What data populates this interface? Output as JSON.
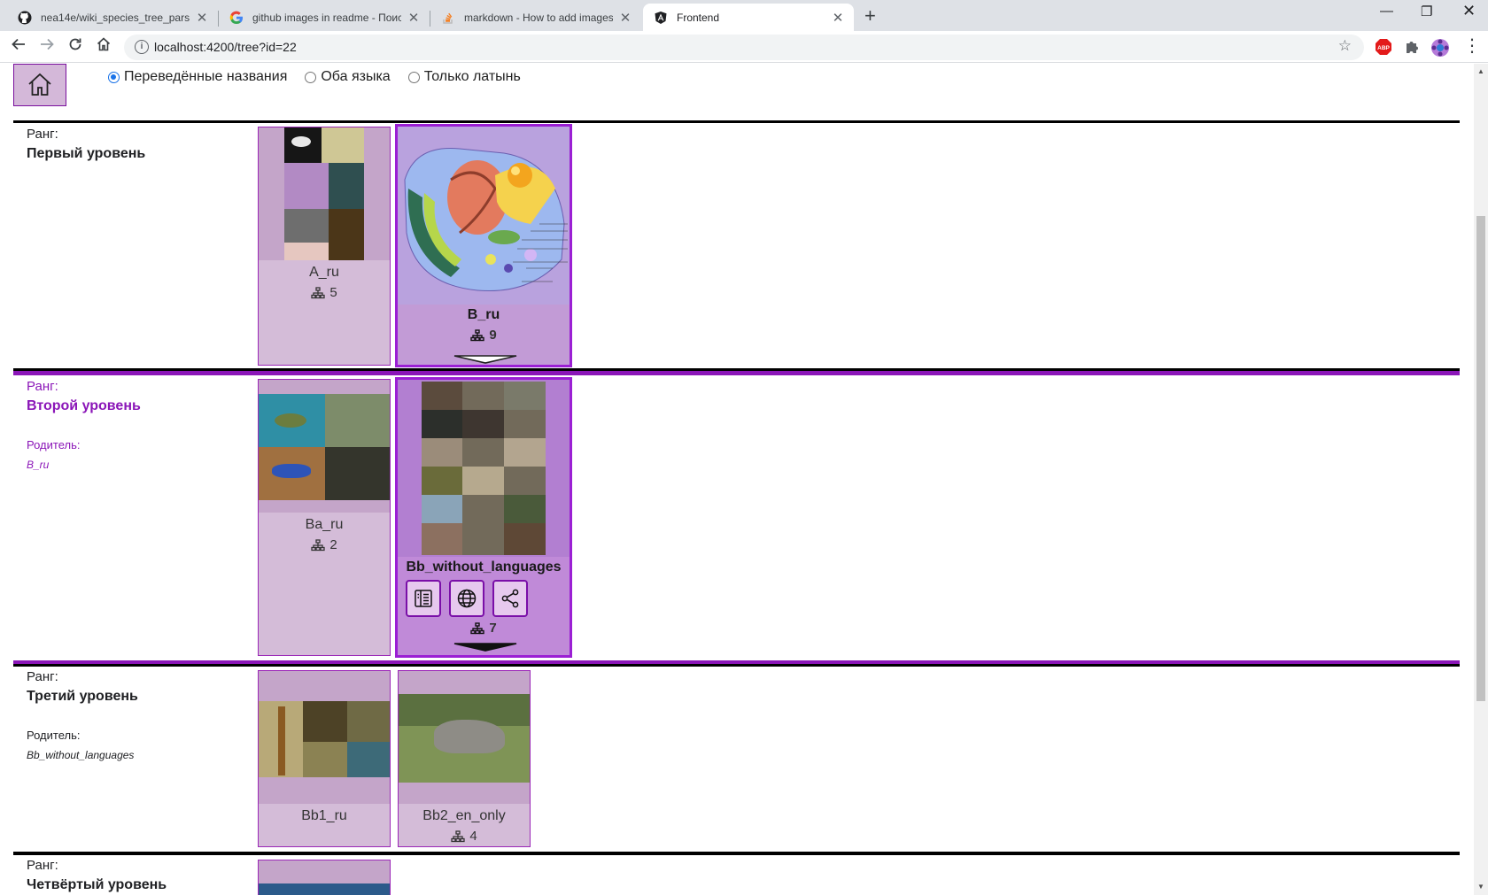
{
  "browser": {
    "tabs": [
      {
        "title": "nea14e/wiki_species_tree_parser",
        "icon": "github-icon"
      },
      {
        "title": "github images in readme - Поиск",
        "icon": "google-icon"
      },
      {
        "title": "markdown - How to add images",
        "icon": "stackoverflow-icon"
      },
      {
        "title": "Frontend",
        "icon": "angular-icon"
      }
    ],
    "url": "localhost:4200/tree?id=22",
    "abp_label": "ABP"
  },
  "controls": {
    "radio_options": [
      "Переведённые названия",
      "Оба языка",
      "Только латынь"
    ],
    "selected_index": 0
  },
  "ranks": [
    {
      "rank_label": "Ранг:",
      "rank_name": "Первый уровень",
      "parent_label": "",
      "parent_name": ""
    },
    {
      "rank_label": "Ранг:",
      "rank_name": "Второй уровень",
      "parent_label": "Родитель:",
      "parent_name": "B_ru"
    },
    {
      "rank_label": "Ранг:",
      "rank_name": "Третий уровень",
      "parent_label": "Родитель:",
      "parent_name": "Bb_without_languages"
    },
    {
      "rank_label": "Ранг:",
      "rank_name": "Четвёртый уровень",
      "parent_label": "",
      "parent_name": ""
    }
  ],
  "cards": {
    "a": {
      "name": "A_ru",
      "count": "5"
    },
    "b": {
      "name": "B_ru",
      "count": "9"
    },
    "ba": {
      "name": "Ba_ru",
      "count": "2"
    },
    "bb": {
      "name": "Bb_without_languages",
      "count": "7"
    },
    "bb1": {
      "name": "Bb1_ru",
      "count": ""
    },
    "bb2": {
      "name": "Bb2_en_only",
      "count": "4"
    }
  },
  "colors": {
    "accent": "#8b16b8",
    "card_bg": "#d4bcd8",
    "selected_card_bg": "#c29bd6"
  }
}
